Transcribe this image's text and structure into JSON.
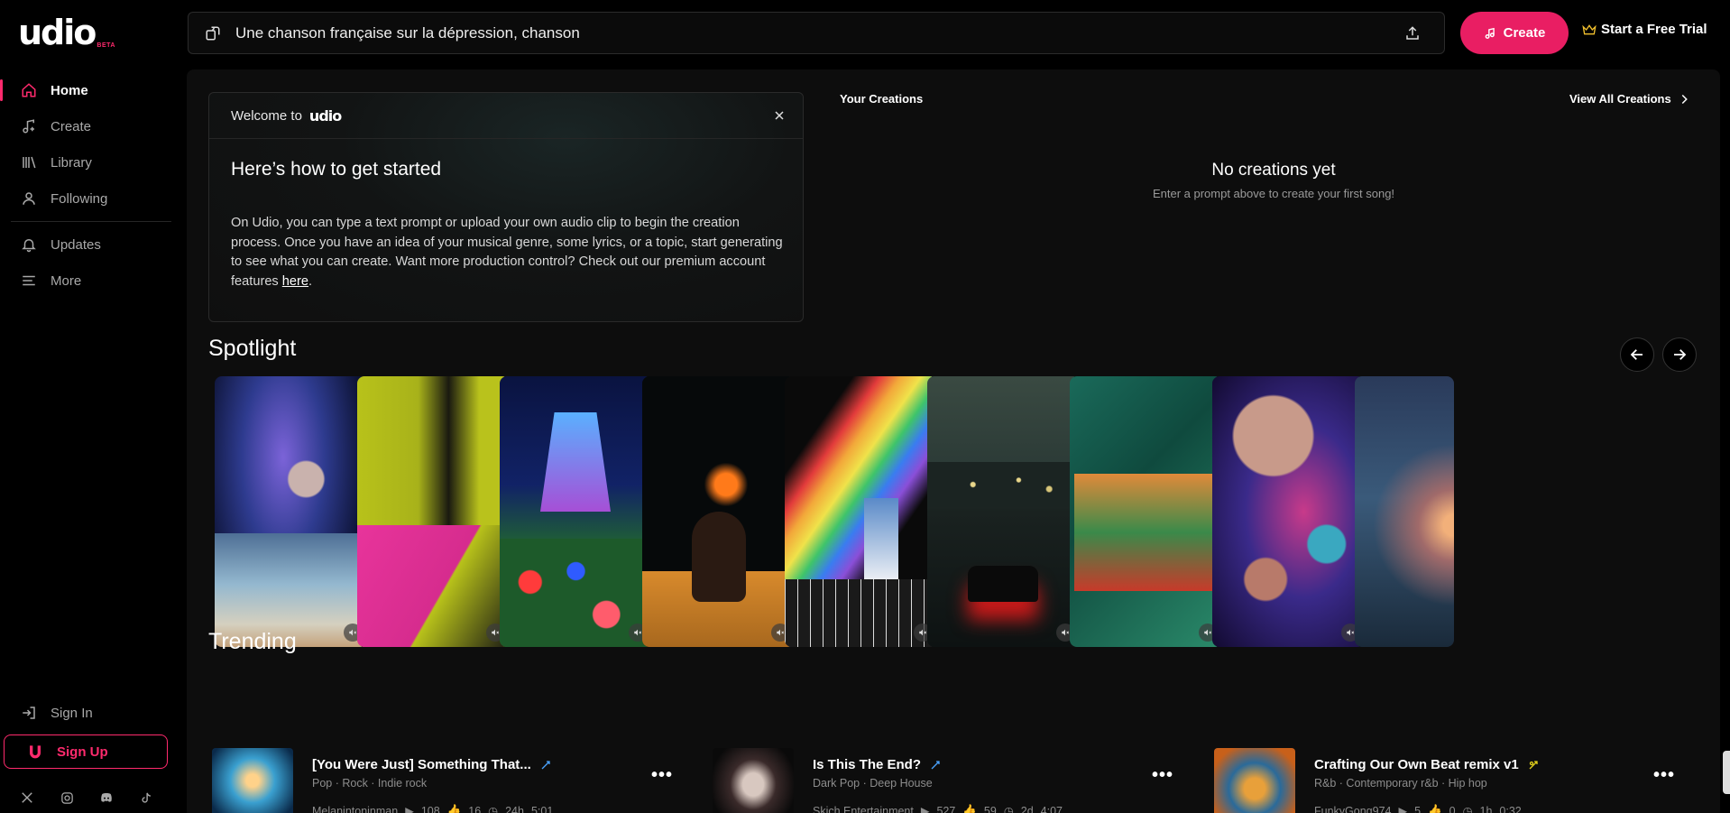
{
  "app": {
    "logo": "udio",
    "logo_badge": "BETA"
  },
  "sidebar": {
    "items": [
      {
        "label": "Home",
        "icon": "home-icon",
        "active": true
      },
      {
        "label": "Create",
        "icon": "music-note-icon"
      },
      {
        "label": "Library",
        "icon": "library-icon"
      },
      {
        "label": "Following",
        "icon": "user-icon"
      }
    ],
    "secondary": [
      {
        "label": "Updates",
        "icon": "bell-icon"
      },
      {
        "label": "More",
        "icon": "menu-icon"
      }
    ],
    "sign_in": "Sign In",
    "sign_up": "Sign Up",
    "socials": [
      "x-icon",
      "instagram-icon",
      "discord-icon",
      "tiktok-icon"
    ]
  },
  "topbar": {
    "prompt_value": "Une chanson française sur la dépression, chanson",
    "create_label": "Create",
    "trial_label": "Start a Free Trial"
  },
  "welcome": {
    "prefix": "Welcome to",
    "logo": "udio",
    "title": "Here’s how to get started",
    "body": "On Udio, you can type a text prompt or upload your own audio clip to begin the creation process. Once you have an idea of your musical genre, some lyrics, or a topic, start generating to see what you can create. Want more production control? Check out our premium account features ",
    "link": "here",
    "body_end": "."
  },
  "creations": {
    "title": "Your Creations",
    "view_all": "View All Creations",
    "empty_title": "No creations yet",
    "empty_sub": "Enter a prompt above to create your first song!"
  },
  "spotlight": {
    "title": "Spotlight",
    "cards": [
      {
        "name": "spotlight-card-cosmic-beach"
      },
      {
        "name": "spotlight-card-cat-figure"
      },
      {
        "name": "spotlight-card-ufo-flowers"
      },
      {
        "name": "spotlight-card-fire-rider"
      },
      {
        "name": "spotlight-card-rainbow-portal"
      },
      {
        "name": "spotlight-card-night-city-car"
      },
      {
        "name": "spotlight-card-painted-figures"
      },
      {
        "name": "spotlight-card-planets"
      },
      {
        "name": "spotlight-card-sunset-landscape"
      }
    ]
  },
  "trending": {
    "title": "Trending",
    "items": [
      {
        "title": "[You Were Just] Something That...",
        "tags": "Pop  ·  Rock  ·  Indie rock",
        "artist": "Melanintoninman",
        "plays": "108",
        "likes": "16",
        "age": "24h",
        "duration": "5:01",
        "badge_color": "#4aa3ff"
      },
      {
        "title": "Is This The End?",
        "tags": "Dark Pop  ·  Deep House",
        "artist": "Skich Entertainment",
        "plays": "527",
        "likes": "59",
        "age": "2d",
        "duration": "4:07",
        "badge_color": "#4aa3ff"
      },
      {
        "title": "Crafting Our Own Beat remix v1",
        "tags": "R&b  ·  Contemporary r&b  ·  Hip hop",
        "artist": "FunkyGong974",
        "plays": "5",
        "likes": "0",
        "age": "1h",
        "duration": "0:32",
        "badge_color": "#e5d21b"
      }
    ]
  },
  "colors": {
    "accent": "#e91e63",
    "background": "#000000",
    "panel": "#0d0d0d"
  }
}
